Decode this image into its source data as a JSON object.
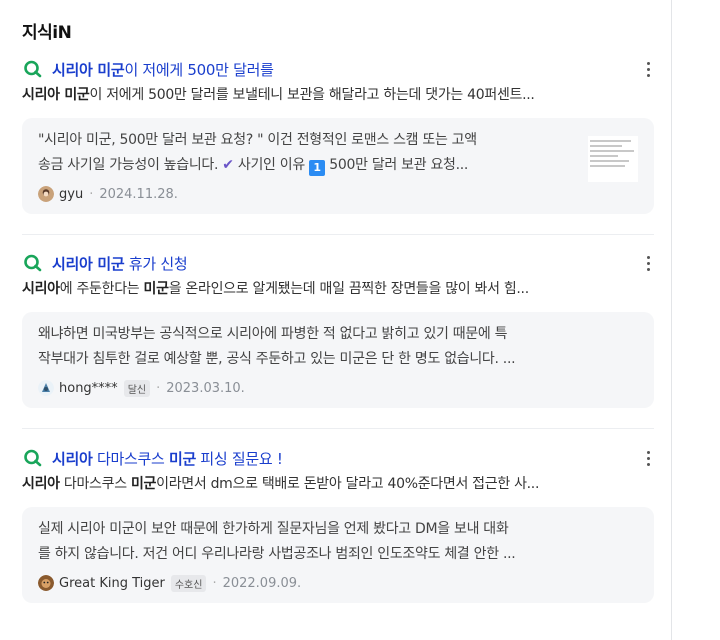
{
  "section": {
    "title": "지식iN"
  },
  "items": [
    {
      "title_parts": [
        {
          "text": "시리아 미군",
          "bold": true
        },
        {
          "text": "이 저에게 500만 달러를",
          "bold": false
        }
      ],
      "snippet_parts": [
        {
          "text": "시리아 미군",
          "bold": true
        },
        {
          "text": "이 저에게 500만 달러를 보낼테니 보관을 해달라고 하는데 댓가는 40퍼센트...",
          "bold": false
        }
      ],
      "answer_line1": "\"시리아 미군, 500만 달러 보관 요청? \" 이건 전형적인 로맨스 스캠 또는 고액",
      "answer_line2_a": "송금 사기일 가능성이 높습니다.",
      "answer_line2_b": "사기인 이유",
      "answer_badge": "1",
      "answer_line2_c": "500만 달러 보관 요청...",
      "check_glyph": "✔",
      "has_thumb": true,
      "user": "gyu",
      "badge": "",
      "date": "2024.11.28."
    },
    {
      "title_parts": [
        {
          "text": "시리아 미군",
          "bold": true
        },
        {
          "text": " 휴가 신청",
          "bold": false
        }
      ],
      "snippet_parts": [
        {
          "text": "시리아",
          "bold": true
        },
        {
          "text": "에 주둔한다는 ",
          "bold": false
        },
        {
          "text": "미군",
          "bold": true
        },
        {
          "text": "을 온라인으로 알게됐는데 매일 끔찍한 장면들을 많이 봐서 힘...",
          "bold": false
        }
      ],
      "answer_line1": "왜냐하면 미국방부는 공식적으로 시리아에 파병한 적 없다고 밝히고 있기 때문에 특",
      "answer_line2": "작부대가 침투한 걸로 예상할 뿐, 공식 주둔하고 있는 미군은 단 한 명도 없습니다. ...",
      "has_thumb": false,
      "user": "hong****",
      "badge": "달신",
      "date": "2023.03.10."
    },
    {
      "title_parts": [
        {
          "text": "시리아",
          "bold": true
        },
        {
          "text": " 다마스쿠스 ",
          "bold": false
        },
        {
          "text": "미군",
          "bold": true
        },
        {
          "text": " 피싱 질문요 !",
          "bold": false
        }
      ],
      "snippet_parts": [
        {
          "text": "시리아",
          "bold": true
        },
        {
          "text": " 다마스쿠스 ",
          "bold": false
        },
        {
          "text": "미군",
          "bold": true
        },
        {
          "text": "이라면서 dm으로 택배로 돈받아 달라고 40%준다면서 접근한 사...",
          "bold": false
        }
      ],
      "answer_line1": "실제 시리아 미군이 보안 때문에 한가하게 질문자님을 언제 봤다고 DM을 보내 대화",
      "answer_line2": "를 하지 않습니다. 저건 어디 우리나라랑 사법공조나 범죄인 인도조약도 체결 안한 ...",
      "has_thumb": false,
      "user": "Great King Tiger",
      "badge": "수호신",
      "date": "2022.09.09."
    }
  ],
  "colors": {
    "title": "#1a3ecd",
    "q_icon": "#19a55a",
    "answer_bg": "#f5f6f8",
    "date": "#8a8f96"
  },
  "icons": {
    "question": "q-search-icon",
    "more": "more-vertical-icon"
  }
}
